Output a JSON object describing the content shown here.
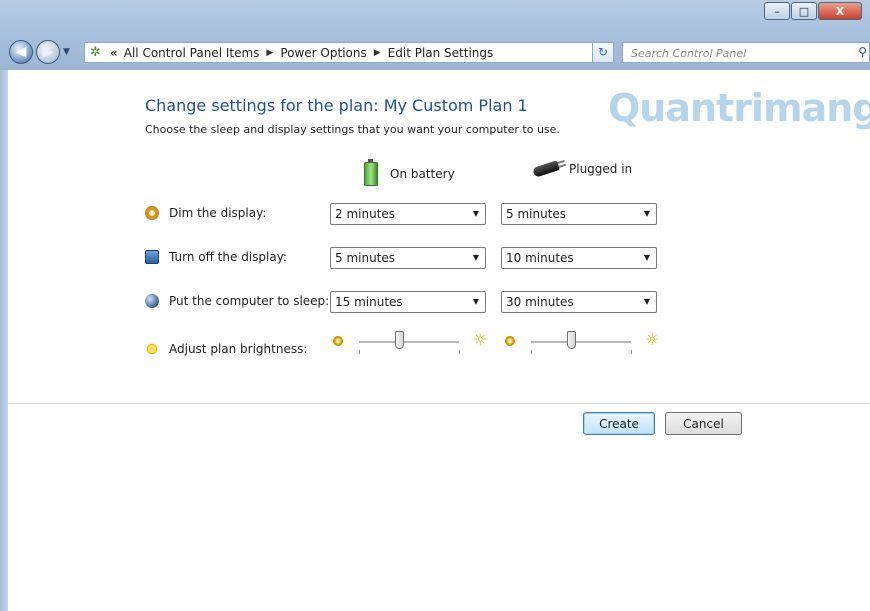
{
  "window": {
    "minimize_label": "–",
    "maximize_label": "□",
    "close_label": "X"
  },
  "nav": {
    "back_glyph": "◀",
    "forward_glyph": "▶",
    "overflow_chevron": "«",
    "breadcrumbs": [
      "All Control Panel Items",
      "Power Options",
      "Edit Plan Settings"
    ],
    "search_placeholder": "Search Control Panel"
  },
  "page": {
    "heading": "Change settings for the plan: My Custom Plan 1",
    "subtext": "Choose the sleep and display settings that you want your computer to use.",
    "watermark": "Quantrimang"
  },
  "columns": {
    "battery": "On battery",
    "plugged": "Plugged in"
  },
  "settings": [
    {
      "label": "Dim the display:",
      "battery": "2 minutes",
      "plugged": "5 minutes"
    },
    {
      "label": "Turn off the display:",
      "battery": "5 minutes",
      "plugged": "10 minutes"
    },
    {
      "label": "Put the computer to sleep:",
      "battery": "15 minutes",
      "plugged": "30 minutes"
    }
  ],
  "brightness": {
    "label": "Adjust plan brightness:",
    "battery_level": 0.4,
    "plugged_level": 0.4
  },
  "buttons": {
    "create": "Create",
    "cancel": "Cancel"
  },
  "icons": {
    "addr": "control-panel-icon",
    "search": "search-icon",
    "refresh": "refresh-icon"
  },
  "colors": {
    "heading": "#1f4fa0",
    "titlebar": "#a7c0dc",
    "primary_button": "#bee4f8"
  }
}
